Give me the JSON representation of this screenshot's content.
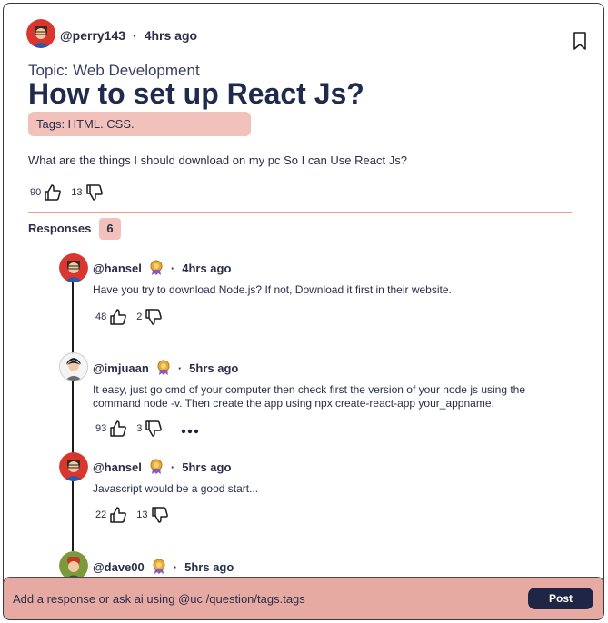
{
  "post": {
    "author": "@perry143",
    "time": "4hrs ago",
    "topic": "Topic: Web Development",
    "title": "How to set up React Js?",
    "tags": "Tags: HTML. CSS.",
    "question": "What are the things I should download on my pc So I can Use React Js?",
    "upvotes": "90",
    "downvotes": "13"
  },
  "responses": {
    "label": "Responses",
    "count": "6",
    "items": [
      {
        "author": "@hansel",
        "time": "4hrs ago",
        "text": "Have you try to download Node.js? If not, Download it first in their website.",
        "up": "48",
        "down": "2"
      },
      {
        "author": "@imjuaan",
        "time": "5hrs ago",
        "text": "It easy, just go cmd of your computer then check first the version of your node js using the command node -v. Then create the app using npx create-react-app your_appname.",
        "up": "93",
        "down": "3"
      },
      {
        "author": "@hansel",
        "time": "5hrs ago",
        "text": "Javascript would be a good start...",
        "up": "22",
        "down": "13"
      },
      {
        "author": "@dave00",
        "time": "5hrs ago"
      }
    ]
  },
  "composer": {
    "placeholder": "Add a response or ask ai using @uc /question/tags.tags",
    "button": "Post"
  },
  "icons": {
    "bookmark": "bookmark-icon",
    "upvote": "thumbs-up-icon",
    "downvote": "thumbs-down-icon",
    "badge": "award-badge-icon",
    "more": "more-options-icon"
  },
  "colors": {
    "accent": "#f3c1bb",
    "divider": "#ee9e8c",
    "composer": "#e7aaa3",
    "button": "#1f2544"
  }
}
